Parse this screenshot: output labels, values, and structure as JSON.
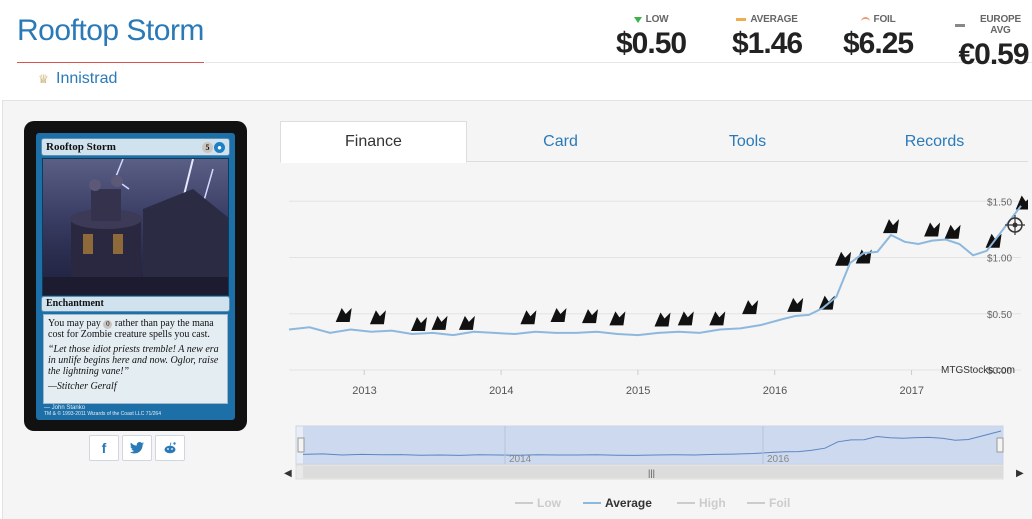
{
  "card": {
    "name": "Rooftop Storm",
    "set_name": "Innistrad",
    "set_icon": "crown-set-icon",
    "mana_cost": "5",
    "type_line": "Enchantment",
    "rules_text": "You may pay {0} rather than pay the mana cost for Zombie creature spells you cast.",
    "rules_prefix": "You may pay",
    "rules_zero": "0",
    "rules_suffix": "rather than pay the mana cost for Zombie creature spells you cast.",
    "flavor_text": "“Let those idiot priests tremble! A new era in unlife begins here and now. Oglor, raise the lightning vane!”",
    "flavor_attrib": "—Stitcher Geralf",
    "artist": "John Stanko",
    "copyright": "TM & © 1993-2011 Wizards of the Coast LLC 71/264"
  },
  "prices": [
    {
      "label": "LOW",
      "value": "$0.50",
      "marker": "down-triangle-icon",
      "color": "#3bb34a"
    },
    {
      "label": "AVERAGE",
      "value": "$1.46",
      "marker": "bar",
      "color": "#f0ad4e"
    },
    {
      "label": "FOIL",
      "value": "$6.25",
      "marker": "curve",
      "color": "#e89a6a"
    },
    {
      "label": "EUROPE AVG",
      "value": "€0.59",
      "marker": "bar",
      "color": "#888888"
    }
  ],
  "tabs": [
    {
      "label": "Finance",
      "active": true
    },
    {
      "label": "Card",
      "active": false
    },
    {
      "label": "Tools",
      "active": false
    },
    {
      "label": "Records",
      "active": false
    }
  ],
  "share": [
    "facebook-icon",
    "twitter-icon",
    "reddit-icon"
  ],
  "colors": {
    "brand": "#2a7ab8",
    "series": "#8cb8de",
    "accent_red": "#d9534f"
  },
  "chart_data": {
    "type": "line",
    "y_ticks": [
      "$1.50",
      "$1.00",
      "$0.50",
      "$0.00"
    ],
    "y_tick_values": [
      1.5,
      1.0,
      0.5,
      0.0
    ],
    "ylim": [
      0,
      1.6
    ],
    "x_ticks": [
      "2013",
      "2014",
      "2015",
      "2016",
      "2017"
    ],
    "watermark": "MTGStocks.com",
    "navigator_labels": [
      "2014",
      "2016"
    ],
    "legend": [
      "Low",
      "Average",
      "High",
      "Foil"
    ],
    "active_series": "Average",
    "series": [
      {
        "name": "Average",
        "x": [
          2012.45,
          2012.6,
          2012.75,
          2012.9,
          2013.05,
          2013.2,
          2013.35,
          2013.5,
          2013.65,
          2013.8,
          2013.95,
          2014.1,
          2014.25,
          2014.4,
          2014.55,
          2014.7,
          2014.85,
          2015.0,
          2015.15,
          2015.3,
          2015.45,
          2015.6,
          2015.75,
          2015.9,
          2016.05,
          2016.15,
          2016.25,
          2016.35,
          2016.45,
          2016.55,
          2016.65,
          2016.75,
          2016.85,
          2016.95,
          2017.05,
          2017.15,
          2017.25,
          2017.35,
          2017.45,
          2017.55,
          2017.65,
          2017.8
        ],
        "values": [
          0.36,
          0.38,
          0.33,
          0.36,
          0.34,
          0.35,
          0.32,
          0.33,
          0.31,
          0.34,
          0.33,
          0.32,
          0.34,
          0.33,
          0.33,
          0.34,
          0.32,
          0.31,
          0.33,
          0.34,
          0.33,
          0.36,
          0.37,
          0.4,
          0.45,
          0.48,
          0.49,
          0.55,
          0.65,
          0.95,
          1.04,
          1.05,
          1.2,
          1.14,
          1.12,
          1.15,
          1.16,
          1.12,
          1.02,
          1.06,
          1.22,
          1.46
        ]
      }
    ],
    "event_icons": [
      {
        "x": 2012.85,
        "y": 0.48
      },
      {
        "x": 2013.1,
        "y": 0.46
      },
      {
        "x": 2013.4,
        "y": 0.4
      },
      {
        "x": 2013.55,
        "y": 0.41
      },
      {
        "x": 2013.75,
        "y": 0.41
      },
      {
        "x": 2014.2,
        "y": 0.46
      },
      {
        "x": 2014.42,
        "y": 0.48
      },
      {
        "x": 2014.65,
        "y": 0.47
      },
      {
        "x": 2014.85,
        "y": 0.45
      },
      {
        "x": 2015.18,
        "y": 0.44
      },
      {
        "x": 2015.35,
        "y": 0.45
      },
      {
        "x": 2015.58,
        "y": 0.45
      },
      {
        "x": 2015.82,
        "y": 0.55
      },
      {
        "x": 2016.15,
        "y": 0.57
      },
      {
        "x": 2016.38,
        "y": 0.59
      },
      {
        "x": 2016.5,
        "y": 0.98
      },
      {
        "x": 2016.65,
        "y": 1.0
      },
      {
        "x": 2016.85,
        "y": 1.27
      },
      {
        "x": 2017.15,
        "y": 1.24
      },
      {
        "x": 2017.3,
        "y": 1.22
      },
      {
        "x": 2017.6,
        "y": 1.14
      },
      {
        "x": 2017.82,
        "y": 1.48
      }
    ]
  }
}
